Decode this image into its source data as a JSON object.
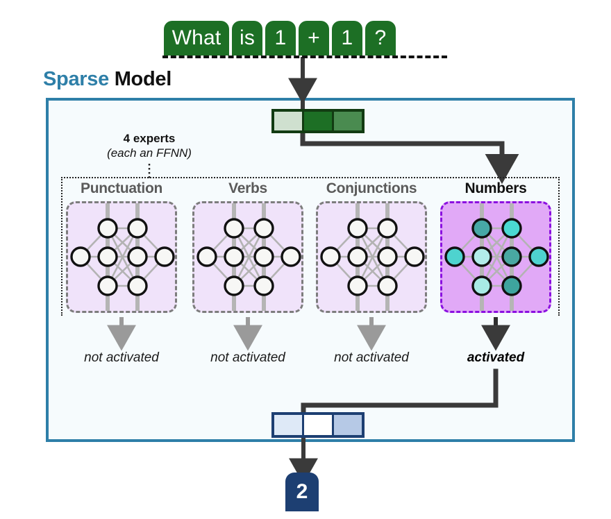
{
  "input": {
    "tokens": [
      {
        "text": "What",
        "wide": true
      },
      {
        "text": "is",
        "wide": false
      },
      {
        "text": "1",
        "wide": false
      },
      {
        "text": "+",
        "wide": false
      },
      {
        "text": "1",
        "wide": false
      },
      {
        "text": "?",
        "wide": false
      }
    ]
  },
  "model": {
    "title_accent": "Sparse",
    "title_plain": "Model",
    "accent_color": "#2e7fa8",
    "border_color": "#2e7fa8",
    "background_color": "#f6fbfd"
  },
  "embedding": {
    "name": "input-embedding-vector",
    "cells": [
      "#cfe0cf",
      "#1d6f25",
      "#4a8b50"
    ],
    "border_color": "#123b12"
  },
  "output_vector": {
    "name": "output-embedding-vector",
    "cells": [
      "#dee9f7",
      "#ffffff",
      "#b6c9e6"
    ],
    "border_color": "#1d3f72"
  },
  "annotation": {
    "line1": "4 experts",
    "line2": "(each an FFNN)"
  },
  "experts": [
    {
      "name": "Punctuation",
      "activated": false,
      "activation_label": "not activated",
      "box_fill": "#f0e3fa",
      "box_border": "#7d7d7d",
      "node_fill": "#f7f7f5",
      "arrow_color": "#9a9a9a"
    },
    {
      "name": "Verbs",
      "activated": false,
      "activation_label": "not activated",
      "box_fill": "#f0e3fa",
      "box_border": "#7d7d7d",
      "node_fill": "#f7f7f5",
      "arrow_color": "#9a9a9a"
    },
    {
      "name": "Conjunctions",
      "activated": false,
      "activation_label": "not activated",
      "box_fill": "#f0e3fa",
      "box_border": "#7d7d7d",
      "node_fill": "#f7f7f5",
      "arrow_color": "#9a9a9a"
    },
    {
      "name": "Numbers",
      "activated": true,
      "activation_label": "activated",
      "box_fill": "#e1a9f7",
      "box_border": "#8b10e0",
      "node_fill": "#45c8c4",
      "arrow_color": "#2f2f2f"
    }
  ],
  "expert_node_colors_active": {
    "input": "#4ed3cf",
    "h1_top": "#47a8a6",
    "h1_mid": "#b2ecea",
    "h1_bot": "#a8ebe5",
    "h2_top": "#4ad9d2",
    "h2_mid": "#49a8a2",
    "h2_bot": "#3ea49e",
    "output": "#4ed3cf"
  },
  "result": {
    "value": "2",
    "chip_color": "#1d3f72"
  },
  "wire_colors": {
    "dark": "#3a3a3a",
    "muted": "#9a9a9a",
    "ffnn_edge": "#b3b3b3",
    "ffnn_rail": "#b5b5b5"
  }
}
